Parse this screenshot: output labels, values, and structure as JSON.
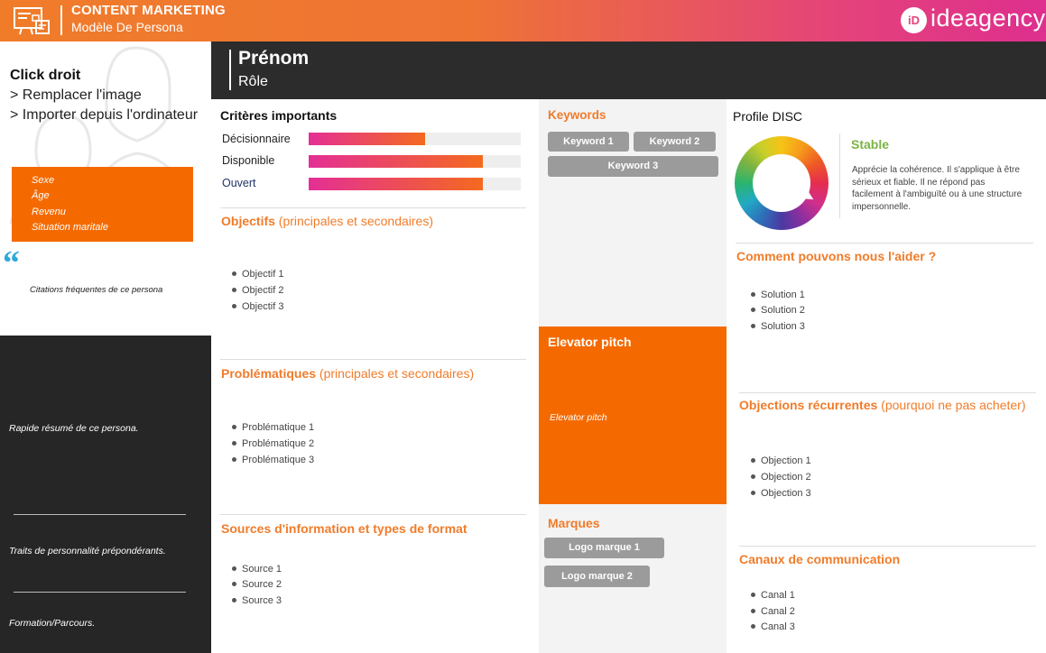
{
  "header": {
    "title": "CONTENT MARKETING",
    "subtitle": "Modèle De Persona",
    "logo_mark": "iD",
    "logo_text": "ideagency",
    "icon": "presentation-board-icon",
    "gradient_colors": [
      "#f07c2a",
      "#de2f8e"
    ]
  },
  "photo_placeholder": {
    "title": "Click droit",
    "line1": "> Remplacer l'image",
    "line2": "> Importer depuis l'ordinateur"
  },
  "demographics": [
    "Sexe",
    "Âge",
    "Revenu",
    "Situation maritale"
  ],
  "quote": {
    "mark": "“",
    "text": "Citations fréquentes de ce persona"
  },
  "dark_panel": {
    "summary": "Rapide résumé  de ce persona.",
    "traits": "Traits de personnalité prépondérants.",
    "education": "Formation/Parcours."
  },
  "persona": {
    "first_name": "Prénom",
    "role": "Rôle"
  },
  "criteria": {
    "title": "Critères importants",
    "items": [
      {
        "label": "Décisionnaire",
        "level": 0.55
      },
      {
        "label": "Disponible",
        "level": 0.82
      },
      {
        "label": "Ouvert",
        "level": 0.82
      }
    ]
  },
  "objectives": {
    "title_bold": "Objectifs",
    "title_rest": " (principales et secondaires)",
    "items": [
      "Objectif 1",
      "Objectif 2",
      "Objectif 3"
    ]
  },
  "problems": {
    "title_bold": "Problématiques",
    "title_rest": " (principales et secondaires)",
    "items": [
      "Problématique 1",
      "Problématique 2",
      "Problématique 3"
    ]
  },
  "sources": {
    "title_bold": "Sources d'information et types de format",
    "items": [
      "Source 1",
      "Source 2",
      "Source 3"
    ]
  },
  "keywords": {
    "title": "Keywords",
    "items": [
      "Keyword 1",
      "Keyword 2",
      "Keyword 3"
    ]
  },
  "pitch": {
    "title": "Elevator pitch",
    "text": "Elevator pitch"
  },
  "brands": {
    "title": "Marques",
    "items": [
      "Logo marque 1",
      "Logo marque 2"
    ]
  },
  "disc": {
    "title": "Profile DISC",
    "type": "Stable",
    "description": "Apprécie la cohérence. Il s'applique à être sérieux et fiable. Il ne répond pas facilement à l'ambiguïté ou à une structure impersonnelle.",
    "accent_color": "#7cb342"
  },
  "help": {
    "title_bold": "Comment pouvons nous l'aider ?",
    "items": [
      "Solution 1",
      "Solution 2",
      "Solution 3"
    ]
  },
  "objections": {
    "title_bold": "Objections récurrentes",
    "title_rest": " (pourquoi ne pas acheter)",
    "items": [
      "Objection 1",
      "Objection 2",
      "Objection 3"
    ]
  },
  "channels": {
    "title_bold": "Canaux de communication",
    "items": [
      "Canal 1",
      "Canal 2",
      "Canal 3"
    ]
  },
  "colors": {
    "orange": "#f56a00",
    "dark": "#262626",
    "accent_text": "#f07c2a"
  }
}
